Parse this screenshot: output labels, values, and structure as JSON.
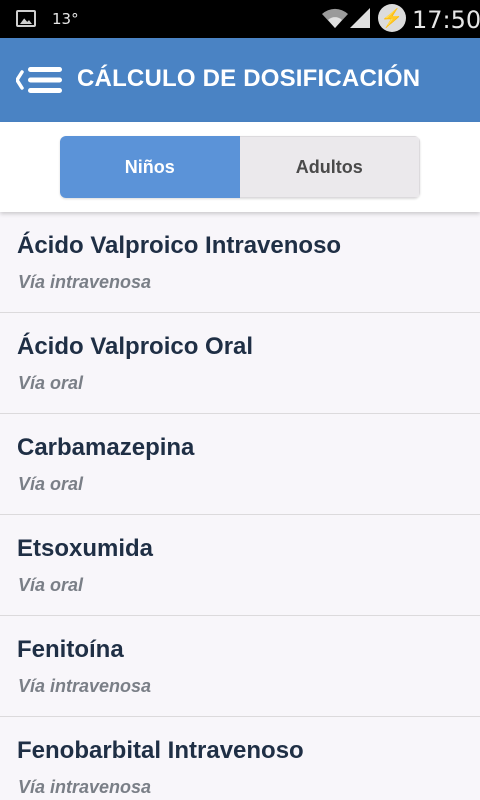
{
  "status_bar": {
    "temperature": "13°",
    "time": "17:50",
    "icons": [
      "gallery-notification-icon",
      "wifi-icon",
      "signal-icon",
      "battery-charging-icon"
    ]
  },
  "header": {
    "title": "CÁLCULO DE DOSIFICACIÓN",
    "menu_icon": "drawer-menu-icon",
    "background": "#4a83c4"
  },
  "segments": {
    "active_color": "#5b93d8",
    "items": [
      {
        "label": "Niños",
        "selected": true
      },
      {
        "label": "Adultos",
        "selected": false
      }
    ]
  },
  "drugs": [
    {
      "name": "Ácido Valproico Intravenoso",
      "route": "Vía intravenosa"
    },
    {
      "name": "Ácido Valproico Oral",
      "route": "Vía oral"
    },
    {
      "name": "Carbamazepina",
      "route": "Vía oral"
    },
    {
      "name": "Etsoxumida",
      "route": "Vía oral"
    },
    {
      "name": "Fenitoína",
      "route": "Vía intravenosa"
    },
    {
      "name": "Fenobarbital Intravenoso",
      "route": "Vía intravenosa"
    }
  ]
}
